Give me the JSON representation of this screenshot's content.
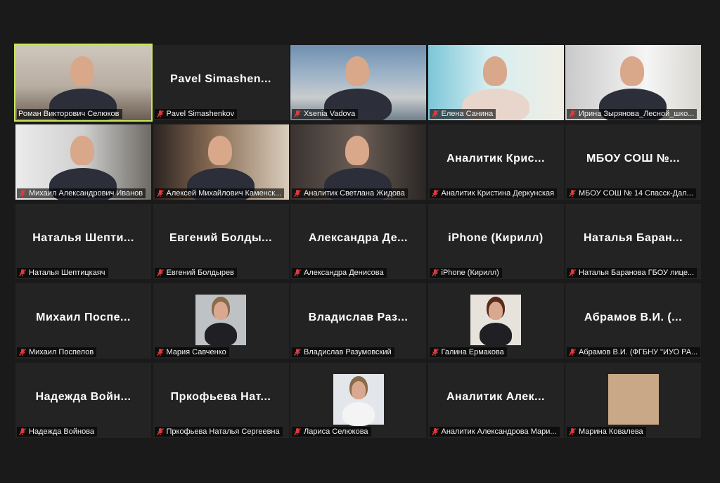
{
  "participants": [
    {
      "label": "Роман Викторович Селюков",
      "display": "",
      "video": "office",
      "active": true,
      "muted": false
    },
    {
      "label": "Pavel Simashenkov",
      "display": "Pavel  Simashen...",
      "video": "",
      "active": false,
      "muted": true
    },
    {
      "label": "Xsenia Vadova",
      "display": "",
      "video": "sky",
      "active": false,
      "muted": true
    },
    {
      "label": "Елена Санина",
      "display": "",
      "video": "light",
      "active": false,
      "muted": true
    },
    {
      "label": "Ирина Зырянова_Лесной_шко...",
      "display": "",
      "video": "room",
      "active": false,
      "muted": true
    },
    {
      "label": "Михаил Александрович Иванов",
      "display": "",
      "video": "window",
      "active": false,
      "muted": true
    },
    {
      "label": "Алексей Михайлович Каменск...",
      "display": "",
      "video": "wood",
      "active": false,
      "muted": true
    },
    {
      "label": "Аналитик Светлана Жидова",
      "display": "",
      "video": "dark",
      "active": false,
      "muted": true
    },
    {
      "label": "Аналитик Кристина Деркунская",
      "display": "Аналитик  Крис...",
      "video": "",
      "active": false,
      "muted": true
    },
    {
      "label": "МБОУ СОШ № 14 Спасск-Дал...",
      "display": "МБОУ  СОШ  №...",
      "video": "",
      "active": false,
      "muted": true
    },
    {
      "label": "Наталья Шептицкаяч",
      "display": "Наталья  Шепти...",
      "video": "",
      "active": false,
      "muted": true
    },
    {
      "label": "Евгений Болдырев",
      "display": "Евгений  Болды...",
      "video": "",
      "active": false,
      "muted": true
    },
    {
      "label": "Александра Денисова",
      "display": "Александра  Де...",
      "video": "",
      "active": false,
      "muted": true
    },
    {
      "label": "iPhone (Кирилл)",
      "display": "iPhone (Кирилл)",
      "video": "",
      "active": false,
      "muted": true
    },
    {
      "label": "Наталья Баранова ГБОУ лице...",
      "display": "Наталья  Баран...",
      "video": "",
      "active": false,
      "muted": true
    },
    {
      "label": "Михаил Поспелов",
      "display": "Михаил  Поспе...",
      "video": "",
      "active": false,
      "muted": true
    },
    {
      "label": "Мария Савченко",
      "display": "",
      "video": "avatar-woman",
      "active": false,
      "muted": true
    },
    {
      "label": "Владислав Разумовский",
      "display": "Владислав  Раз...",
      "video": "",
      "active": false,
      "muted": true
    },
    {
      "label": "Галина Ермакова",
      "display": "",
      "video": "avatar-woman2",
      "active": false,
      "muted": true
    },
    {
      "label": "Абрамов В.И. (ФГБНУ \"ИУО РА...",
      "display": "Абрамов В.И. (...",
      "video": "",
      "active": false,
      "muted": true
    },
    {
      "label": "Надежда Войнова",
      "display": "Надежда  Войн...",
      "video": "",
      "active": false,
      "muted": true
    },
    {
      "label": "Пркофьева Наталья Сергеевна",
      "display": "Пркофьева  Нат...",
      "video": "",
      "active": false,
      "muted": true
    },
    {
      "label": "Лариса Селюкова",
      "display": "",
      "video": "avatar-woman3",
      "active": false,
      "muted": true
    },
    {
      "label": "Аналитик Александрова Мари...",
      "display": "Аналитик  Алек...",
      "video": "",
      "active": false,
      "muted": true
    },
    {
      "label": "Марина Ковалева",
      "display": "",
      "video": "avatar-hearts",
      "active": false,
      "muted": true
    }
  ],
  "colors": {
    "active_border": "#c8e65a",
    "mic_muted": "#e23b3b",
    "tile_bg": "#232323",
    "page_bg": "#1a1a1a"
  }
}
